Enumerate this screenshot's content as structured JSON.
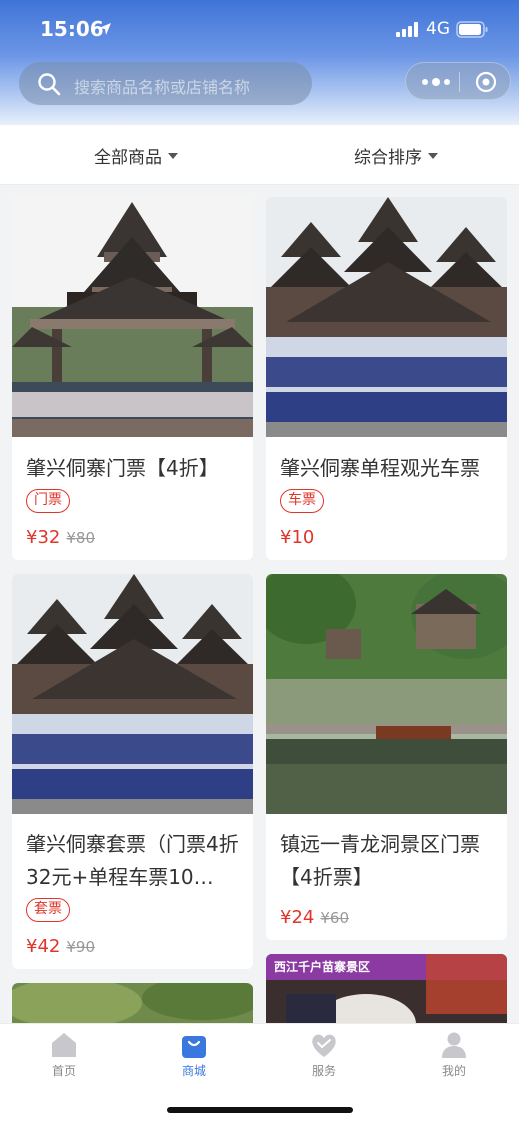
{
  "status_bar": {
    "time": "15:06",
    "network": "4G"
  },
  "search": {
    "placeholder": "搜索商品名称或店铺名称"
  },
  "filters": [
    {
      "label": "全部商品"
    },
    {
      "label": "综合排序"
    }
  ],
  "products": [
    {
      "title": "肇兴侗寨门票【4折】",
      "tag": "门票",
      "price": "¥32",
      "original_price": "¥80"
    },
    {
      "title": "肇兴侗寨单程观光车票",
      "tag": "车票",
      "price": "¥10",
      "original_price": ""
    },
    {
      "title": "肇兴侗寨套票（门票4折32元+单程车票10…",
      "tag": "套票",
      "price": "¥42",
      "original_price": "¥90"
    },
    {
      "title": "镇远一青龙洞景区门票【4折票】",
      "tag": "",
      "price": "¥24",
      "original_price": "¥60"
    },
    {
      "title": "",
      "banner_text": "西江千户苗寨景区"
    }
  ],
  "tabs": [
    {
      "label": "首页",
      "icon": "home-icon",
      "active": false
    },
    {
      "label": "商城",
      "icon": "shop-bag-icon",
      "active": true
    },
    {
      "label": "服务",
      "icon": "heart-icon",
      "active": false
    },
    {
      "label": "我的",
      "icon": "user-icon",
      "active": false
    }
  ],
  "colors": {
    "accent": "#3a78e0",
    "price": "#e0352b",
    "tab_inactive": "#888888"
  }
}
